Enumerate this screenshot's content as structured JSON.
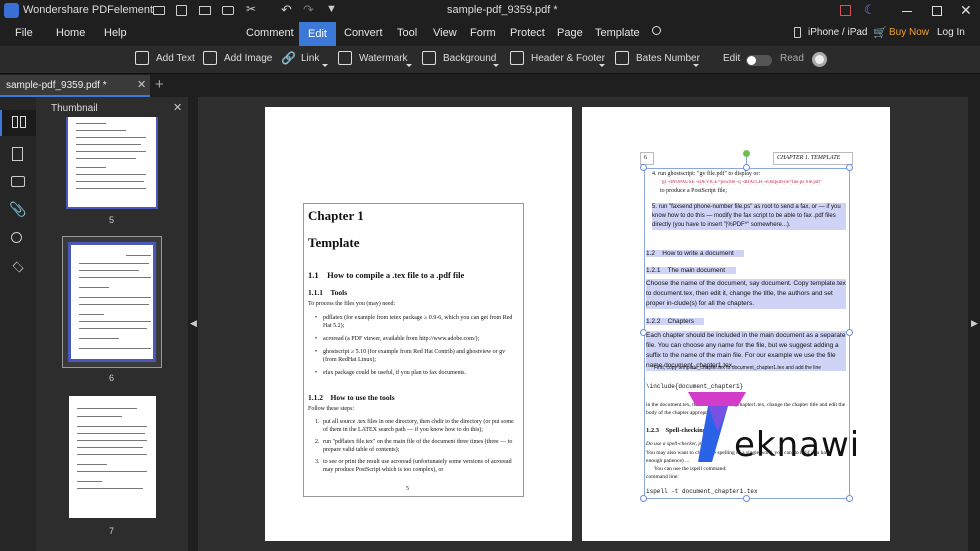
{
  "app": {
    "name": "Wondershare PDFelement",
    "doc_title": "sample-pdf_9359.pdf *"
  },
  "menu": {
    "left": [
      "File",
      "Home",
      "Help"
    ],
    "center": [
      "Comment",
      "Edit",
      "Convert",
      "Tool",
      "View",
      "Form",
      "Protect",
      "Page",
      "Template"
    ],
    "active": "Edit",
    "device": "iPhone / iPad",
    "buy": "Buy Now",
    "login": "Log In"
  },
  "toolbar": {
    "add_text": "Add Text",
    "add_image": "Add Image",
    "link": "Link",
    "watermark": "Watermark",
    "background": "Background",
    "header_footer": "Header & Footer",
    "bates": "Bates Number",
    "edit": "Edit",
    "read": "Read",
    "edit_mode_on": true
  },
  "tab": {
    "label": "sample-pdf_9359.pdf *"
  },
  "thumbnail_panel": {
    "title": "Thumbnail",
    "pages": [
      "5",
      "6",
      "7"
    ],
    "selected": "6"
  },
  "page_left": {
    "chapter": "Chapter 1",
    "title": "Template",
    "s1_1": "1.1    How to compile a .tex file to a .pdf file",
    "s1_1_1": "1.1.1    Tools",
    "intro": "To process the files you (may) need:",
    "bullets": [
      "pdflatex (for example from tetex package ≥ 0.9-6, which you can get from Red Hat 5.2);",
      "acroread (a PDF viewer, available from http://www.adobe.com/);",
      "ghostscript ≥ 5.10 (for example from Red Hat Contrib) and ghostview or gv (from RedHat Linux);",
      "efax package could be useful, if you plan to fax documents."
    ],
    "s1_1_2": "1.1.2    How to use the tools",
    "follow": "Follow these steps:",
    "steps": [
      "put all source .tex files in one directory, then chdir to the directory (or put some of them in the LATEX search path — if you know how to do this);",
      "run \"pdflatex file.tex\" on the main file of the document three times (three — to prepare valid table of contents);",
      "to see or print the result use acroread (unfortunately some versions of acroread may produce PostScript which is too complex), or"
    ],
    "page_num": "5"
  },
  "page_right": {
    "page_num": "6",
    "header": "CHAPTER 1.  TEMPLATE",
    "item4": "4. run ghostscript: \"gv file.pdf\" to display or:",
    "item4b": "\"gs -dNOPAUSE -sDEVICE=pswrite -q -dBATCH -sOutputFile=file.ps file.pdf\"",
    "item4c": "to produce a PostScript file;",
    "item5": "5. run \"faxsend phone-number file.ps\" as root to send a fax, or — if you know how to do this — modify the fax script to be able to fax .pdf files directly (you have to insert \"|%PDF*\" somewhere...).",
    "s1_2": "1.2    How to write a document",
    "s1_2_1": "1.2.1    The main document",
    "p1": "Choose the name of the document, say document. Copy template.tex to document.tex, then edit it, change the title, the authors and set proper in-clude(s) for all the chapters.",
    "s1_2_2": "1.2.2    Chapters",
    "p2": "Each chapter should be included in the main document as a separate file. You can choose any name for the file, but we suggest adding a suffix to the name of the main file. For our example we use the file name document_chapter1.tex.",
    "p2b": "First, copy template_chapter.tex to document_chapter1.tex and add the line",
    "code1": "\\include{document_chapter1}",
    "p3": "in the document.tex, then edit document_chapter1.tex, change the chapter title and edit the body of the chapter appropriately.",
    "s1_2_3": "1.2.3    Spell-checking",
    "p4": "Do use a spell-checker, please!",
    "p5": "You may also want to check the spelling of a single word, you can do it (if you have enough patience) ...",
    "p6": "You can use the ispell command:",
    "p6b": "command line:",
    "code2": "ispell -t document_chapter1.tex"
  },
  "watermark_logo": "eknawi",
  "colors": {
    "accent": "#3c78d8",
    "buy": "#f0a030",
    "logo_magenta": "#d23cc8",
    "logo_blue": "#2a62e8"
  }
}
